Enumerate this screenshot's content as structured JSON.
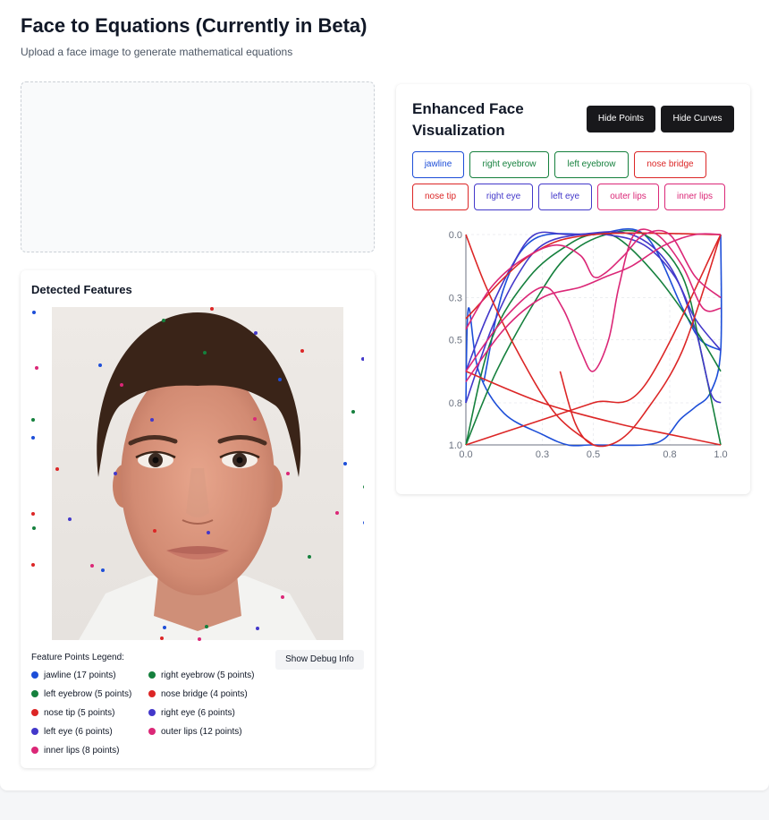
{
  "header": {
    "title": "Face to Equations (Currently in Beta)",
    "subtitle": "Upload a face image to generate mathematical equations"
  },
  "detected": {
    "title": "Detected Features",
    "legend_title": "Feature Points Legend:",
    "debug_button": "Show Debug Info",
    "legend": [
      {
        "label": "jawline (17 points)",
        "color": "#1d4ed8"
      },
      {
        "label": "right eyebrow (5 points)",
        "color": "#15803d"
      },
      {
        "label": "left eyebrow (5 points)",
        "color": "#15803d"
      },
      {
        "label": "nose bridge (4 points)",
        "color": "#dc2626"
      },
      {
        "label": "nose tip (5 points)",
        "color": "#dc2626"
      },
      {
        "label": "right eye (6 points)",
        "color": "#4338ca"
      },
      {
        "label": "left eye (6 points)",
        "color": "#4338ca"
      },
      {
        "label": "outer lips (12 points)",
        "color": "#db2777"
      },
      {
        "label": "inner lips (8 points)",
        "color": "#db2777"
      }
    ]
  },
  "viz": {
    "title": "Enhanced Face Visualization",
    "hide_points": "Hide Points",
    "hide_curves": "Hide Curves",
    "chips": [
      {
        "label": "jawline",
        "color": "#1d4ed8"
      },
      {
        "label": "right eyebrow",
        "color": "#15803d"
      },
      {
        "label": "left eyebrow",
        "color": "#15803d"
      },
      {
        "label": "nose bridge",
        "color": "#dc2626"
      },
      {
        "label": "nose tip",
        "color": "#dc2626"
      },
      {
        "label": "right eye",
        "color": "#4338ca"
      },
      {
        "label": "left eye",
        "color": "#4338ca"
      },
      {
        "label": "outer lips",
        "color": "#db2777"
      },
      {
        "label": "inner lips",
        "color": "#db2777"
      }
    ]
  },
  "chart_data": {
    "type": "line",
    "xlim": [
      0,
      1
    ],
    "ylim": [
      0,
      1
    ],
    "y_inverted": true,
    "x_ticks": [
      "0.0",
      "0.3",
      "0.5",
      "0.8",
      "1.0"
    ],
    "y_ticks": [
      "0.0",
      "0.3",
      "0.5",
      "0.8",
      "1.0"
    ],
    "grid": true,
    "series": [
      {
        "group": "jawline",
        "color": "#1d4ed8",
        "points": [
          [
            0.0,
            0.8
          ],
          [
            0.01,
            0.35
          ],
          [
            0.05,
            0.65
          ],
          [
            0.15,
            0.85
          ],
          [
            0.3,
            0.95
          ],
          [
            0.4,
            1.0
          ],
          [
            0.5,
            1.0
          ],
          [
            0.7,
            1.0
          ],
          [
            0.78,
            0.97
          ],
          [
            0.84,
            0.88
          ],
          [
            0.9,
            0.82
          ],
          [
            0.96,
            0.75
          ],
          [
            1.0,
            0.55
          ],
          [
            1.0,
            0.0
          ]
        ]
      },
      {
        "group": "jawline",
        "color": "#1d4ed8",
        "points": [
          [
            0.07,
            0.7
          ],
          [
            0.15,
            0.25
          ],
          [
            0.27,
            0.02
          ],
          [
            0.5,
            0.0
          ],
          [
            0.7,
            0.0
          ],
          [
            0.85,
            0.35
          ],
          [
            0.92,
            0.5
          ],
          [
            1.0,
            0.55
          ]
        ]
      },
      {
        "group": "right eyebrow",
        "color": "#15803d",
        "points": [
          [
            0.0,
            1.0
          ],
          [
            0.1,
            0.5
          ],
          [
            0.25,
            0.2
          ],
          [
            0.4,
            0.05
          ],
          [
            0.5,
            0.0
          ],
          [
            0.6,
            0.02
          ],
          [
            0.75,
            0.2
          ],
          [
            0.9,
            0.45
          ],
          [
            1.0,
            0.65
          ]
        ]
      },
      {
        "group": "left eyebrow",
        "color": "#15803d",
        "points": [
          [
            0.0,
            1.0
          ],
          [
            0.12,
            0.65
          ],
          [
            0.28,
            0.3
          ],
          [
            0.4,
            0.1
          ],
          [
            0.55,
            0.0
          ],
          [
            0.7,
            0.0
          ],
          [
            0.85,
            0.2
          ],
          [
            0.93,
            0.6
          ],
          [
            1.0,
            1.0
          ]
        ]
      },
      {
        "group": "right eye",
        "color": "#4338ca",
        "points": [
          [
            0.0,
            0.65
          ],
          [
            0.08,
            0.4
          ],
          [
            0.18,
            0.15
          ],
          [
            0.27,
            0.0
          ],
          [
            0.4,
            0.0
          ],
          [
            0.55,
            0.0
          ],
          [
            0.7,
            0.05
          ],
          [
            0.82,
            0.2
          ],
          [
            0.9,
            0.4
          ],
          [
            1.0,
            0.55
          ]
        ]
      },
      {
        "group": "left eye",
        "color": "#4338ca",
        "points": [
          [
            0.0,
            0.8
          ],
          [
            0.1,
            0.45
          ],
          [
            0.2,
            0.2
          ],
          [
            0.3,
            0.05
          ],
          [
            0.45,
            0.0
          ],
          [
            0.65,
            0.0
          ],
          [
            0.8,
            0.15
          ],
          [
            0.9,
            0.45
          ],
          [
            0.96,
            0.75
          ],
          [
            1.0,
            0.8
          ]
        ]
      },
      {
        "group": "nose bridge",
        "color": "#dc2626",
        "points": [
          [
            0.0,
            0.0
          ],
          [
            0.08,
            0.25
          ],
          [
            0.2,
            0.55
          ],
          [
            0.35,
            0.85
          ],
          [
            0.5,
            1.0
          ]
        ]
      },
      {
        "group": "nose bridge",
        "color": "#dc2626",
        "points": [
          [
            0.0,
            0.4
          ],
          [
            0.25,
            0.1
          ],
          [
            0.5,
            0.0
          ],
          [
            1.0,
            0.0
          ]
        ]
      },
      {
        "group": "nose tip",
        "color": "#dc2626",
        "points": [
          [
            0.0,
            0.65
          ],
          [
            0.3,
            0.8
          ],
          [
            0.6,
            0.9
          ],
          [
            0.8,
            0.95
          ],
          [
            1.0,
            1.0
          ]
        ]
      },
      {
        "group": "nose tip",
        "color": "#dc2626",
        "points": [
          [
            0.0,
            1.0
          ],
          [
            0.25,
            0.9
          ],
          [
            0.5,
            0.8
          ],
          [
            0.7,
            0.72
          ],
          [
            1.0,
            0.0
          ]
        ]
      },
      {
        "group": "nose tip",
        "color": "#dc2626",
        "points": [
          [
            0.37,
            0.65
          ],
          [
            0.43,
            0.9
          ],
          [
            0.5,
            1.0
          ],
          [
            0.6,
            0.98
          ],
          [
            0.7,
            0.85
          ],
          [
            0.85,
            0.55
          ],
          [
            1.0,
            0.0
          ]
        ]
      },
      {
        "group": "outer lips",
        "color": "#db2777",
        "points": [
          [
            0.0,
            0.45
          ],
          [
            0.1,
            0.25
          ],
          [
            0.22,
            0.12
          ],
          [
            0.35,
            0.05
          ],
          [
            0.45,
            0.1
          ],
          [
            0.5,
            0.2
          ],
          [
            0.55,
            0.18
          ],
          [
            0.62,
            0.1
          ],
          [
            0.7,
            0.0
          ],
          [
            0.8,
            0.0
          ],
          [
            0.9,
            0.2
          ],
          [
            1.0,
            0.3
          ]
        ]
      },
      {
        "group": "outer lips",
        "color": "#db2777",
        "points": [
          [
            0.0,
            0.65
          ],
          [
            0.15,
            0.4
          ],
          [
            0.3,
            0.25
          ],
          [
            0.38,
            0.35
          ],
          [
            0.45,
            0.55
          ],
          [
            0.5,
            0.65
          ],
          [
            0.56,
            0.5
          ],
          [
            0.6,
            0.25
          ],
          [
            0.66,
            0.0
          ],
          [
            0.75,
            0.0
          ],
          [
            0.85,
            0.15
          ],
          [
            0.93,
            0.35
          ],
          [
            1.0,
            0.35
          ]
        ]
      },
      {
        "group": "inner lips",
        "color": "#db2777",
        "points": [
          [
            0.0,
            0.7
          ],
          [
            0.15,
            0.45
          ],
          [
            0.3,
            0.3
          ],
          [
            0.45,
            0.25
          ],
          [
            0.55,
            0.2
          ],
          [
            0.65,
            0.15
          ],
          [
            0.78,
            0.05
          ],
          [
            0.9,
            0.0
          ],
          [
            1.0,
            0.0
          ]
        ]
      }
    ]
  }
}
